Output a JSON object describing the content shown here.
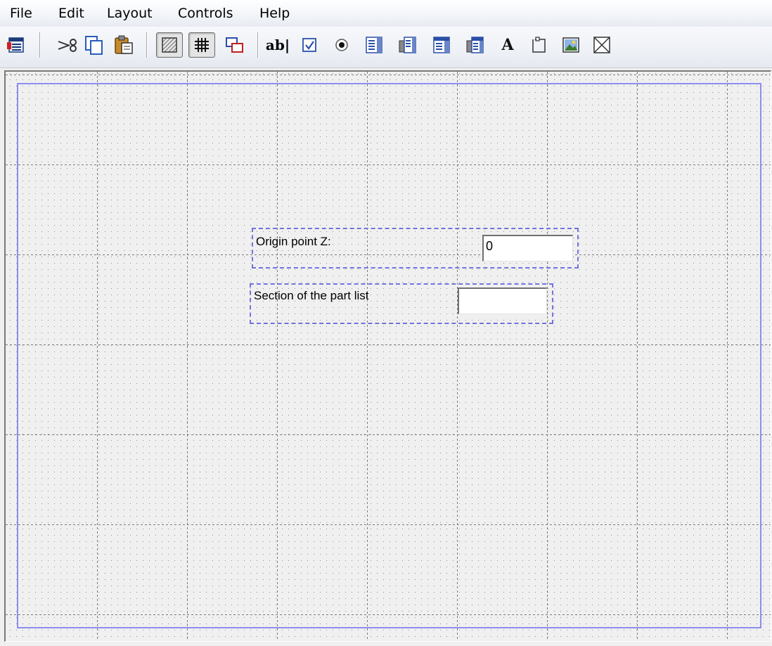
{
  "menu": [
    "File",
    "Edit",
    "Layout",
    "Controls",
    "Help"
  ],
  "toolbar": {
    "icons": [
      "form-properties-icon",
      "cut-icon",
      "copy-icon",
      "paste-icon",
      "grid-show-icon",
      "grid-snap-icon",
      "tab-order-icon",
      "text-field-icon",
      "checkbox-icon",
      "radio-button-icon",
      "list-box-icon",
      "combo-box-icon",
      "list-box-2-icon",
      "combo-box-2-icon",
      "static-text-icon",
      "group-box-icon",
      "picture-icon",
      "placeholder-icon"
    ],
    "text_field_glyph": "ab|",
    "static_text_glyph": "A"
  },
  "form": {
    "fields": [
      {
        "label": "Origin point Z:",
        "value": "0"
      },
      {
        "label": "Section of the part list",
        "value": ""
      }
    ]
  },
  "colors": {
    "selection": "#7272e0",
    "form_outline": "#8d8df0"
  }
}
